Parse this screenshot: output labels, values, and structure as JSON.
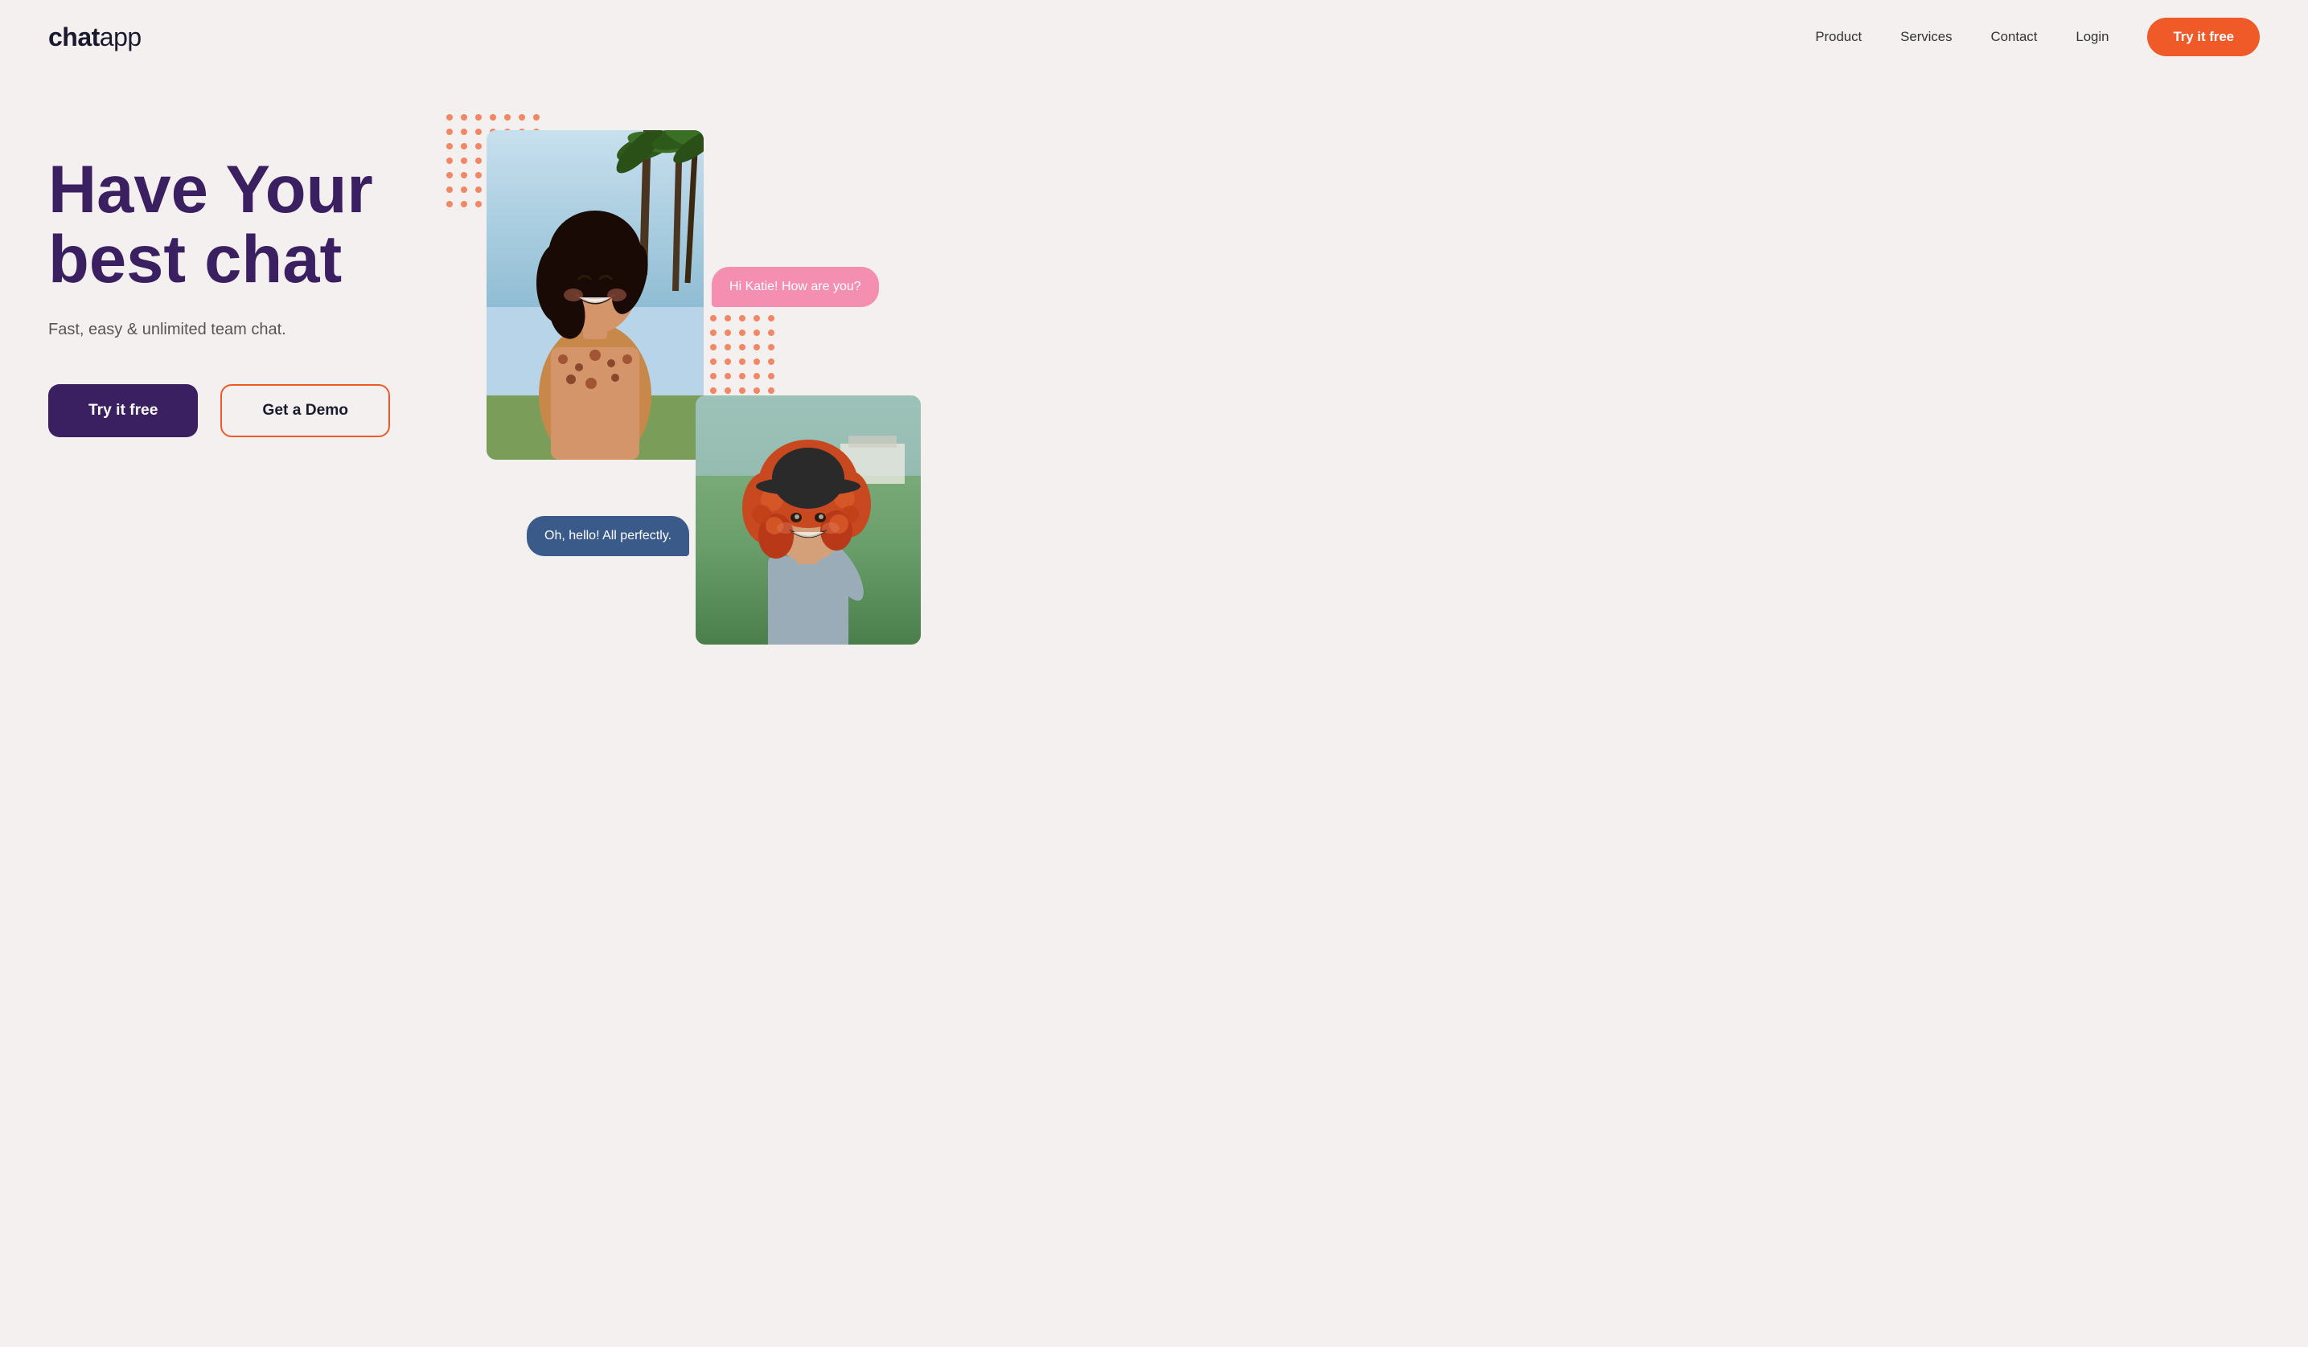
{
  "brand": {
    "name_bold": "chat",
    "name_thin": "app"
  },
  "nav": {
    "links": [
      {
        "id": "product",
        "label": "Product"
      },
      {
        "id": "services",
        "label": "Services"
      },
      {
        "id": "contact",
        "label": "Contact"
      },
      {
        "id": "login",
        "label": "Login"
      }
    ],
    "cta_label": "Try it free"
  },
  "hero": {
    "title_line1": "Have  Your",
    "title_line2": "best chat",
    "subtitle": "Fast, easy & unlimited team chat.",
    "btn_primary": "Try it free",
    "btn_secondary": "Get a Demo"
  },
  "chat": {
    "bubble_pink": "Hi Katie! How are you?",
    "bubble_blue": "Oh, hello! All perfectly."
  },
  "colors": {
    "bg": "#f5f0f0",
    "primary_purple": "#3a2060",
    "accent_orange": "#f05a28",
    "chat_pink": "#f48fb1",
    "chat_blue": "#3a5a8a"
  }
}
